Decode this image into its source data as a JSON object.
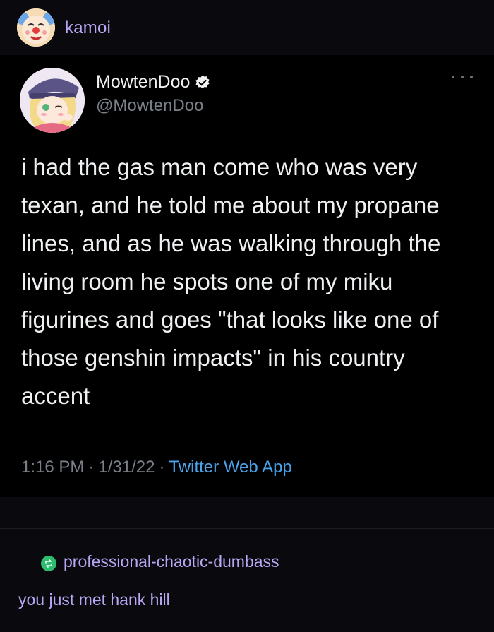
{
  "reblog": {
    "blog_name": "kamoi",
    "avatar_icon": "clown-avatar-icon"
  },
  "tweet": {
    "display_name": "MowtenDoo",
    "handle": "@MowtenDoo",
    "verified": true,
    "text": "i had the gas man come who was very texan, and he told me about my propane lines, and as he was walking through the living room he spots one of my miku figurines and goes \"that looks like one of those genshin impacts\" in his country accent",
    "time": "1:16 PM",
    "date": "1/31/22",
    "separator": "·",
    "source": "Twitter Web App"
  },
  "reblogger": {
    "name": "professional-chaotic-dumbass",
    "icon": "reblog-icon",
    "comment": "you just met hank hill"
  },
  "colors": {
    "background": "#0a0a0e",
    "tumblr_accent": "#b9a7f5",
    "twitter_blue": "#4aa2ea",
    "reblog_green": "#2dbd6e"
  }
}
